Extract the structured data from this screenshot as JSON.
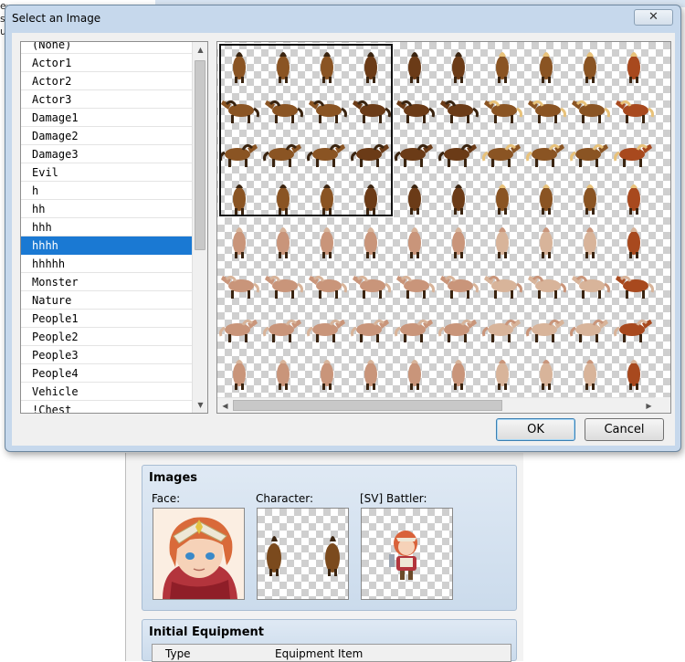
{
  "background_app": {
    "left_strip_text": [
      "ese",
      "si",
      "u"
    ],
    "images_group": {
      "title": "Images",
      "face_label": "Face:",
      "character_label": "Character:",
      "battler_label": "[SV] Battler:"
    },
    "equipment_group": {
      "title": "Initial Equipment",
      "col_type": "Type",
      "col_item": "Equipment Item"
    }
  },
  "dialog": {
    "title": "Select an Image",
    "close_glyph": "✕",
    "ok_label": "OK",
    "cancel_label": "Cancel"
  },
  "image_list": {
    "items": [
      "(None)",
      "Actor1",
      "Actor2",
      "Actor3",
      "Damage1",
      "Damage2",
      "Damage3",
      "Evil",
      "h",
      "hh",
      "hhh",
      "hhhh",
      "hhhhh",
      "Monster",
      "Nature",
      "People1",
      "People2",
      "People3",
      "People4",
      "Vehicle",
      "!Chest"
    ],
    "selected_index": 11
  },
  "preview": {
    "columns": 10,
    "rows": 8,
    "selected_block": "top-left character (3 columns × 4 rows)",
    "horse_colors": {
      "dark_brown": "#6b3b17",
      "brown": "#8a5423",
      "reddish": "#a8491e",
      "pink_tan": "#c9957a",
      "pale": "#d8b49a",
      "mane_light": "#e8c27a",
      "mane_dark": "#3a2410"
    }
  },
  "icons": {
    "scroll_up": "▲",
    "scroll_down": "▼",
    "scroll_left": "◀",
    "scroll_right": "▶"
  }
}
